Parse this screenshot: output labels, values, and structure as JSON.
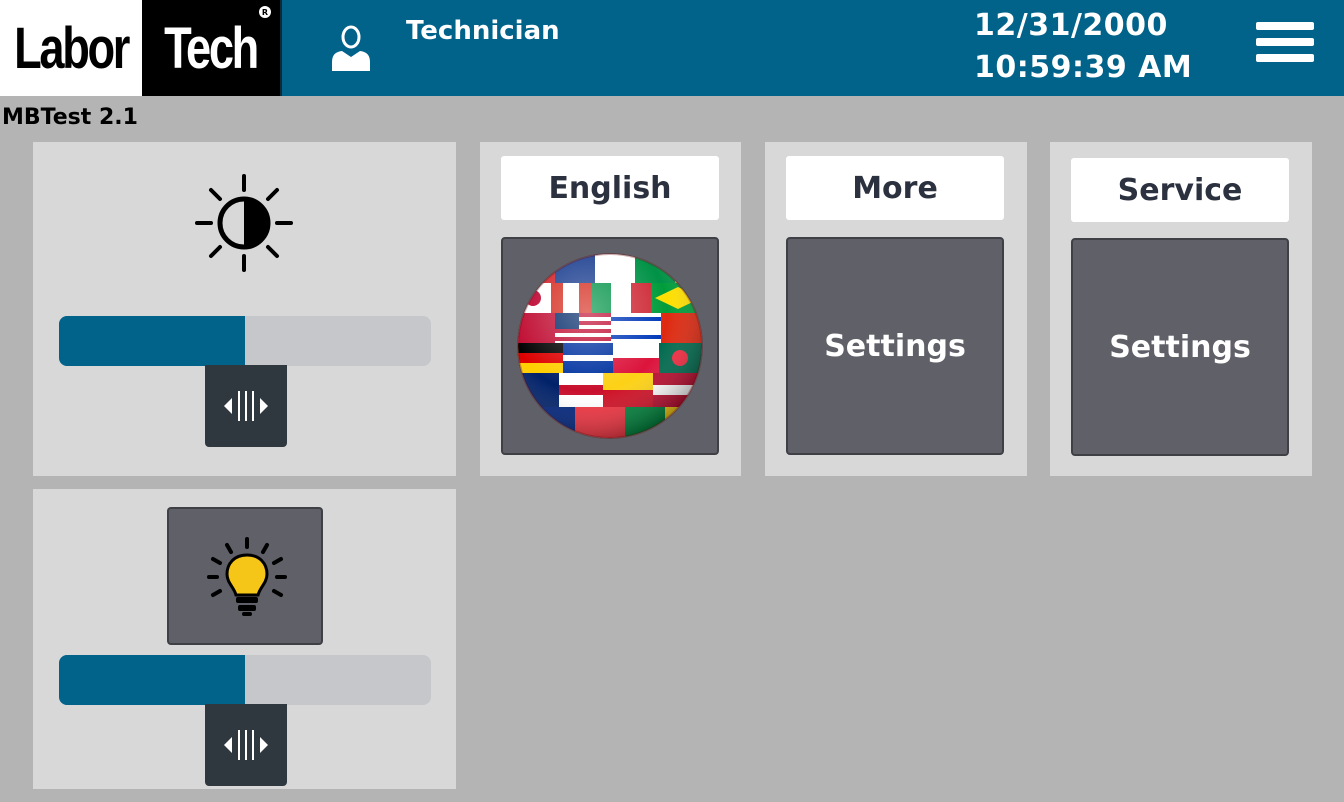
{
  "header": {
    "logo_left": "Labor",
    "logo_right": "Tech",
    "logo_registered": "R",
    "user_icon": "user-icon",
    "user_name": "Technician",
    "date": "12/31/2000",
    "time": "10:59:39 AM",
    "menu_icon": "hamburger-menu-icon"
  },
  "version": "MBTest 2.1",
  "brightness": {
    "icon": "brightness-contrast-icon",
    "level_percent": 50,
    "handle_icon": "slider-grip-icon"
  },
  "light": {
    "icon": "light-bulb-icon",
    "level_percent": 50,
    "handle_icon": "slider-grip-icon"
  },
  "tiles": [
    {
      "label": "English",
      "button_text": "",
      "button_icon": "flags-globe-icon"
    },
    {
      "label": "More",
      "button_text": "Settings"
    },
    {
      "label": "Service",
      "button_text": "Settings"
    }
  ],
  "colors": {
    "header_bg": "#01628a",
    "background": "#b4b4b4",
    "panel_bg": "#d8d8d8",
    "button_bg": "#5f6068",
    "slider_fill": "#01628a",
    "slider_track": "#c5c7ca",
    "bulb": "#f5c518"
  }
}
